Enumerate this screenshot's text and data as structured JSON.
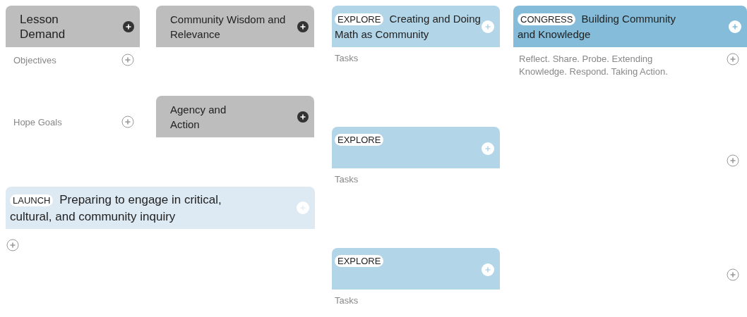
{
  "lesson_demand": {
    "title": "Lesson Demand",
    "items": [
      {
        "label": "Objectives"
      },
      {
        "label": "Hope Goals"
      }
    ]
  },
  "community_wisdom": {
    "title": "Community Wisdom and Relevance"
  },
  "agency": {
    "title": "Agency and Action"
  },
  "launch": {
    "tag": "LAUNCH",
    "title": "Preparing to engage in critical, cultural, and community inquiry"
  },
  "explore_cards": [
    {
      "tag": "EXPLORE",
      "title": "Creating and Doing Math as Community",
      "note": "Tasks"
    },
    {
      "tag": "EXPLORE",
      "note": "Tasks"
    },
    {
      "tag": "EXPLORE",
      "note": "Tasks"
    }
  ],
  "congress": {
    "tag": "CONGRESS",
    "title": "Building Community and Knowledge",
    "note": "Reflect. Share. Probe. Extending Knowledge. Respond. Taking Action."
  }
}
